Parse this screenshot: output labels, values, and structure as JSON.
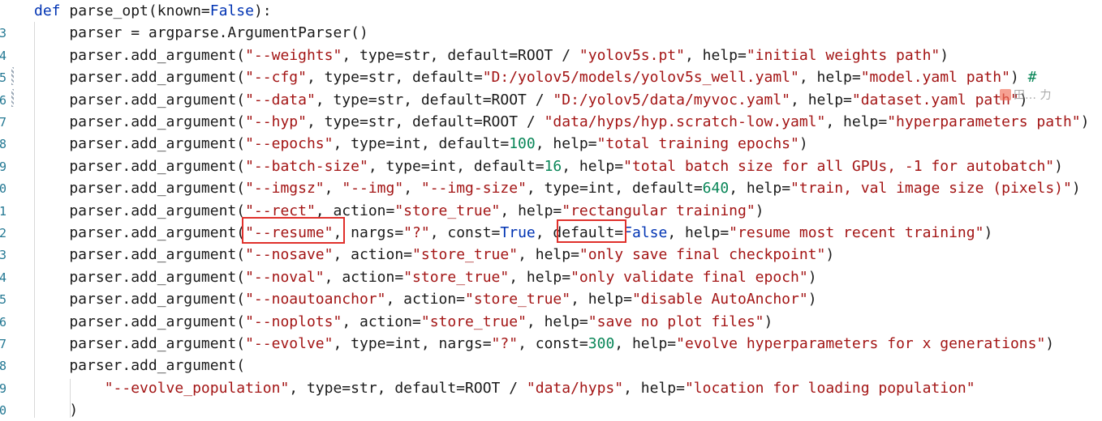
{
  "editor": {
    "line_numbers": [
      "",
      "3",
      "4",
      "5",
      "6",
      "7",
      "8",
      "9",
      "0",
      "1",
      "2",
      "3",
      "4",
      "5",
      "6",
      "7",
      "8",
      "9",
      "0"
    ],
    "colors": {
      "keyword": "#0033b3",
      "string": "#a31515",
      "number": "#098658",
      "highlight_box": "#e0302b",
      "line_number": "#237893"
    },
    "lines": [
      [
        [
          "kw",
          "def "
        ],
        [
          "pn",
          "parse_opt(known="
        ],
        [
          "kw",
          "False"
        ],
        [
          "pn",
          "):"
        ]
      ],
      [
        [
          "pn",
          "    parser = argparse.ArgumentParser()"
        ]
      ],
      [
        [
          "pn",
          "    parser.add_argument("
        ],
        [
          "st",
          "\"--weights\""
        ],
        [
          "pn",
          ", type=str, default=ROOT / "
        ],
        [
          "st",
          "\"yolov5s.pt\""
        ],
        [
          "pn",
          ", help="
        ],
        [
          "st",
          "\"initial weights path\""
        ],
        [
          "pn",
          ")"
        ]
      ],
      [
        [
          "pn",
          "    parser.add_argument("
        ],
        [
          "st",
          "\"--cfg\""
        ],
        [
          "pn",
          ", type=str, default="
        ],
        [
          "st",
          "\"D:/yolov5/models/yolov5s_well.yaml\""
        ],
        [
          "pn",
          ", help="
        ],
        [
          "st",
          "\"model.yaml path\""
        ],
        [
          "pn",
          ") "
        ],
        [
          "nm",
          "#"
        ]
      ],
      [
        [
          "pn",
          "    parser.add_argument("
        ],
        [
          "st",
          "\"--data\""
        ],
        [
          "pn",
          ", type=str, default=ROOT / "
        ],
        [
          "st",
          "\"D:/yolov5/data/myvoc.yaml\""
        ],
        [
          "pn",
          ", help="
        ],
        [
          "st",
          "\"dataset.yaml path\""
        ],
        [
          "pn",
          ")"
        ]
      ],
      [
        [
          "pn",
          "    parser.add_argument("
        ],
        [
          "st",
          "\"--hyp\""
        ],
        [
          "pn",
          ", type=str, default=ROOT / "
        ],
        [
          "st",
          "\"data/hyps/hyp.scratch-low.yaml\""
        ],
        [
          "pn",
          ", help="
        ],
        [
          "st",
          "\"hyperparameters path\""
        ],
        [
          "pn",
          ")"
        ]
      ],
      [
        [
          "pn",
          "    parser.add_argument("
        ],
        [
          "st",
          "\"--epochs\""
        ],
        [
          "pn",
          ", type=int, default="
        ],
        [
          "nm",
          "100"
        ],
        [
          "pn",
          ", help="
        ],
        [
          "st",
          "\"total training epochs\""
        ],
        [
          "pn",
          ")"
        ]
      ],
      [
        [
          "pn",
          "    parser.add_argument("
        ],
        [
          "st",
          "\"--batch-size\""
        ],
        [
          "pn",
          ", type=int, default="
        ],
        [
          "nm",
          "16"
        ],
        [
          "pn",
          ", help="
        ],
        [
          "st",
          "\"total batch size for all GPUs, -1 for autobatch\""
        ],
        [
          "pn",
          ")"
        ]
      ],
      [
        [
          "pn",
          "    parser.add_argument("
        ],
        [
          "st",
          "\"--imgsz\""
        ],
        [
          "pn",
          ", "
        ],
        [
          "st",
          "\"--img\""
        ],
        [
          "pn",
          ", "
        ],
        [
          "st",
          "\"--img-size\""
        ],
        [
          "pn",
          ", type=int, default="
        ],
        [
          "nm",
          "640"
        ],
        [
          "pn",
          ", help="
        ],
        [
          "st",
          "\"train, val image size (pixels)\""
        ],
        [
          "pn",
          ")"
        ]
      ],
      [
        [
          "pn",
          "    parser.add_argument("
        ],
        [
          "st",
          "\"--rect\""
        ],
        [
          "pn",
          ", action="
        ],
        [
          "st",
          "\"store_true\""
        ],
        [
          "pn",
          ", help="
        ],
        [
          "st",
          "\"rectangular training\""
        ],
        [
          "pn",
          ")"
        ]
      ],
      [
        [
          "pn",
          "    parser.add_argument("
        ],
        [
          "st",
          "\"--resume\""
        ],
        [
          "pn",
          ", nargs="
        ],
        [
          "st",
          "\"?\""
        ],
        [
          "pn",
          ", const="
        ],
        [
          "kw",
          "True"
        ],
        [
          "pn",
          ", default="
        ],
        [
          "kw",
          "False"
        ],
        [
          "pn",
          ", help="
        ],
        [
          "st",
          "\"resume most recent training\""
        ],
        [
          "pn",
          ")"
        ]
      ],
      [
        [
          "pn",
          "    parser.add_argument("
        ],
        [
          "st",
          "\"--nosave\""
        ],
        [
          "pn",
          ", action="
        ],
        [
          "st",
          "\"store_true\""
        ],
        [
          "pn",
          ", help="
        ],
        [
          "st",
          "\"only save final checkpoint\""
        ],
        [
          "pn",
          ")"
        ]
      ],
      [
        [
          "pn",
          "    parser.add_argument("
        ],
        [
          "st",
          "\"--noval\""
        ],
        [
          "pn",
          ", action="
        ],
        [
          "st",
          "\"store_true\""
        ],
        [
          "pn",
          ", help="
        ],
        [
          "st",
          "\"only validate final epoch\""
        ],
        [
          "pn",
          ")"
        ]
      ],
      [
        [
          "pn",
          "    parser.add_argument("
        ],
        [
          "st",
          "\"--noautoanchor\""
        ],
        [
          "pn",
          ", action="
        ],
        [
          "st",
          "\"store_true\""
        ],
        [
          "pn",
          ", help="
        ],
        [
          "st",
          "\"disable AutoAnchor\""
        ],
        [
          "pn",
          ")"
        ]
      ],
      [
        [
          "pn",
          "    parser.add_argument("
        ],
        [
          "st",
          "\"--noplots\""
        ],
        [
          "pn",
          ", action="
        ],
        [
          "st",
          "\"store_true\""
        ],
        [
          "pn",
          ", help="
        ],
        [
          "st",
          "\"save no plot files\""
        ],
        [
          "pn",
          ")"
        ]
      ],
      [
        [
          "pn",
          "    parser.add_argument("
        ],
        [
          "st",
          "\"--evolve\""
        ],
        [
          "pn",
          ", type=int, nargs="
        ],
        [
          "st",
          "\"?\""
        ],
        [
          "pn",
          ", const="
        ],
        [
          "nm",
          "300"
        ],
        [
          "pn",
          ", help="
        ],
        [
          "st",
          "\"evolve hyperparameters for x generations\""
        ],
        [
          "pn",
          ")"
        ]
      ],
      [
        [
          "pn",
          "    parser.add_argument("
        ]
      ],
      [
        [
          "pn",
          "        "
        ],
        [
          "st",
          "\"--evolve_population\""
        ],
        [
          "pn",
          ", type=str, default=ROOT / "
        ],
        [
          "st",
          "\"data/hyps\""
        ],
        [
          "pn",
          ", help="
        ],
        [
          "st",
          "\"location for loading population\""
        ]
      ],
      [
        [
          "pn",
          "    )"
        ]
      ]
    ]
  },
  "overlay": {
    "watermark_text": "田… 力"
  }
}
